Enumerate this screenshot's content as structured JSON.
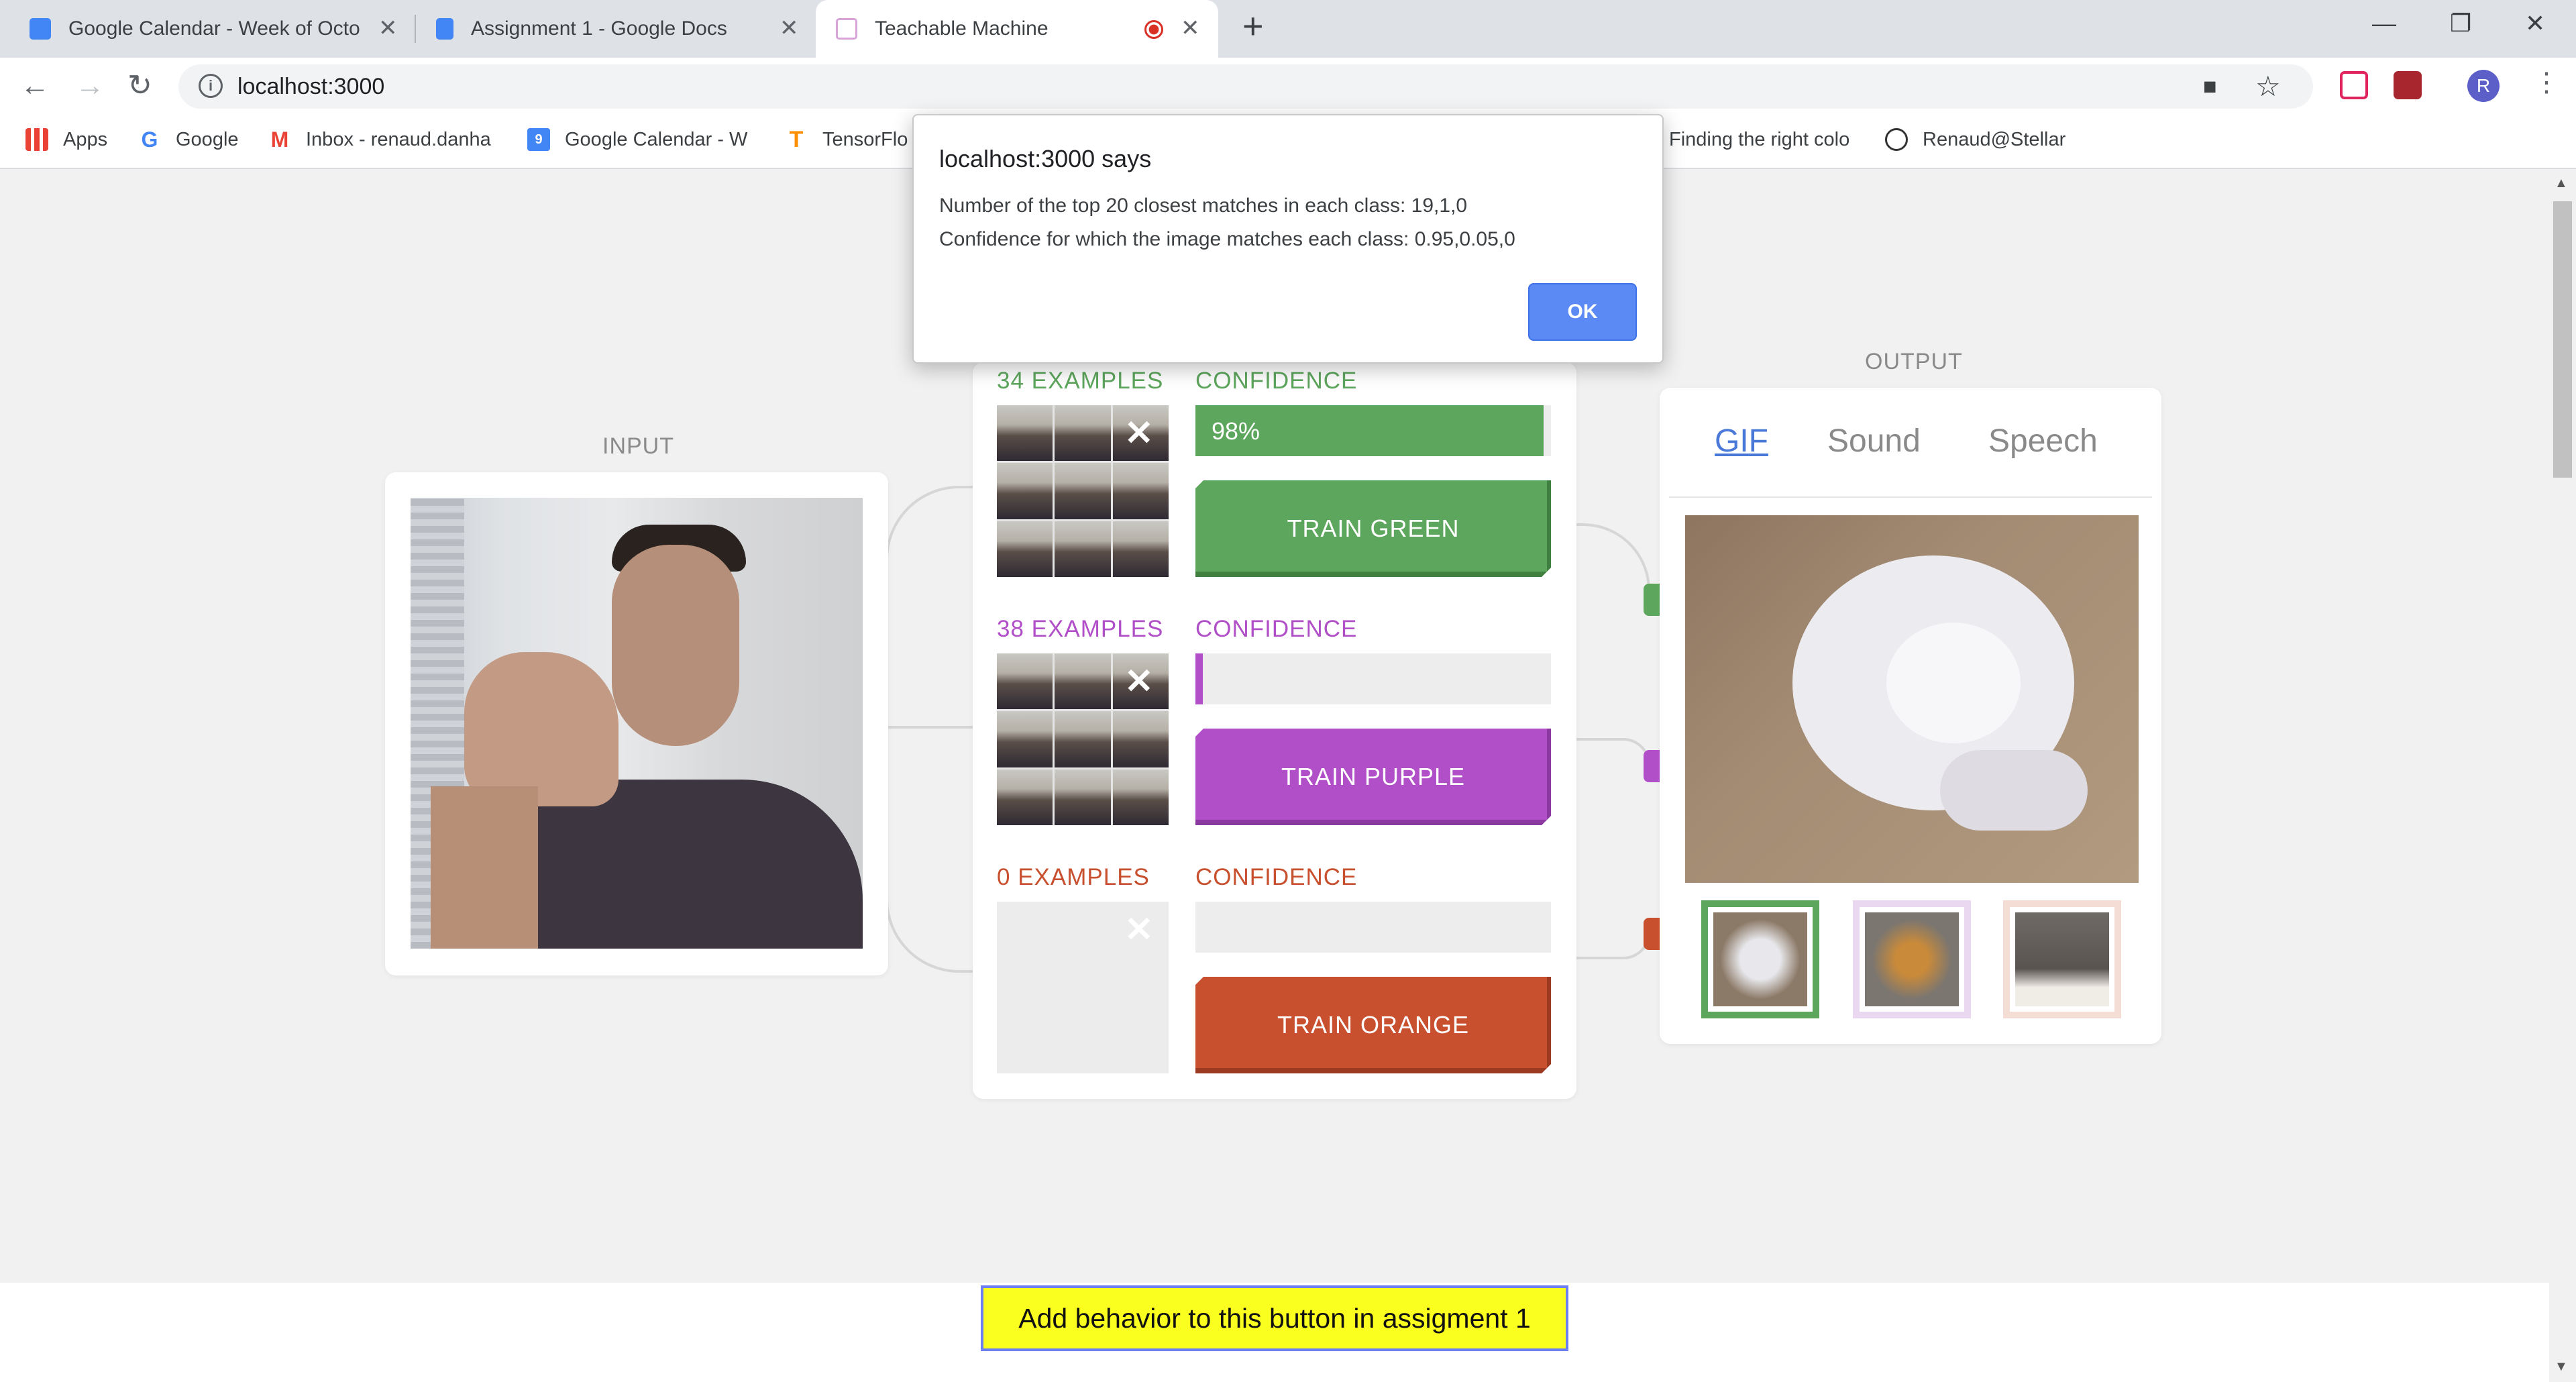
{
  "browser": {
    "tabs": [
      {
        "title": "Google Calendar - Week of Octo",
        "icon": "google-calendar-icon"
      },
      {
        "title": "Assignment 1 - Google Docs",
        "icon": "google-docs-icon"
      },
      {
        "title": "Teachable Machine",
        "icon": "teachable-machine-icon",
        "recording": true
      }
    ],
    "url": "localhost:3000",
    "profile_initial": "R",
    "bookmarks": [
      {
        "label": "Apps",
        "icon": "apps-grid-icon"
      },
      {
        "label": "Google",
        "icon": "google-icon"
      },
      {
        "label": "Inbox - renaud.danha",
        "icon": "gmail-icon"
      },
      {
        "label": "Google Calendar - W",
        "icon": "calendar-icon"
      },
      {
        "label": "TensorFlo",
        "icon": "tensorflow-icon"
      },
      {
        "label": "Finding the right colo",
        "icon": ""
      },
      {
        "label": "Renaud@Stellar",
        "icon": "stellar-icon"
      }
    ]
  },
  "dialog": {
    "title": "localhost:3000 says",
    "line1": "Number of the top 20 closest matches in each class: 19,1,0",
    "line2": "Confidence for which the image matches each class: 0.95,0.05,0",
    "ok_label": "OK"
  },
  "input": {
    "label": "INPUT"
  },
  "classes": [
    {
      "examples": "34 EXAMPLES",
      "confidence_label": "CONFIDENCE",
      "confidence_text": "98%",
      "confidence": 0.98,
      "button": "TRAIN GREEN",
      "color": "#5da65d"
    },
    {
      "examples": "38 EXAMPLES",
      "confidence_label": "CONFIDENCE",
      "confidence_text": "",
      "confidence": 0.02,
      "button": "TRAIN PURPLE",
      "color": "#b04fc7"
    },
    {
      "examples": "0 EXAMPLES",
      "confidence_label": "CONFIDENCE",
      "confidence_text": "",
      "confidence": 0,
      "button": "TRAIN ORANGE",
      "color": "#c8502f"
    }
  ],
  "output": {
    "label": "OUTPUT",
    "tabs": [
      "GIF",
      "Sound",
      "Speech"
    ],
    "active_tab": "GIF"
  },
  "footer": {
    "button": "Add behavior to this button in assigment 1"
  }
}
